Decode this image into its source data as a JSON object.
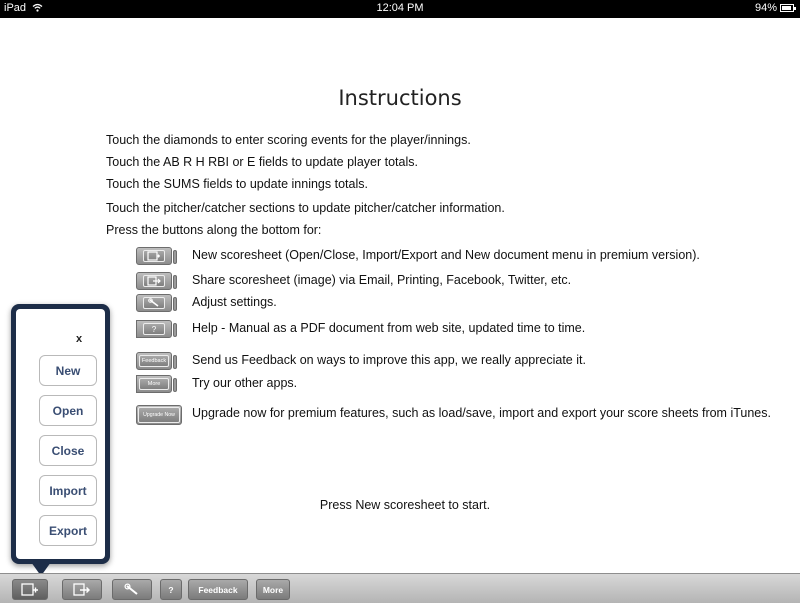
{
  "status_bar": {
    "device": "iPad",
    "time": "12:04 PM",
    "battery": "94%",
    "battery_level": 0.94
  },
  "instructions": {
    "title": "Instructions",
    "lines": [
      "Touch the diamonds to enter scoring events for the player/innings.",
      "Touch the AB R H RBI or E fields to update player totals.",
      "Touch the SUMS fields to update innings totals.",
      "Touch the pitcher/catcher sections to update pitcher/catcher information.",
      "Press the buttons along the bottom for:"
    ],
    "buttons": [
      {
        "icon": "new-scoresheet-icon",
        "label": "",
        "text": "New scoresheet (Open/Close, Import/Export and New document menu in premium version)."
      },
      {
        "icon": "share-icon",
        "label": "",
        "text": "Share scoresheet (image) via Email, Printing, Facebook, Twitter, etc."
      },
      {
        "icon": "wrench-icon",
        "label": "",
        "text": "Adjust settings."
      },
      {
        "icon": "help-icon",
        "label": "?",
        "text": "Help - Manual as a PDF document from web site, updated time to time."
      },
      {
        "icon": "feedback-icon",
        "label": "Feedback",
        "text": "Send us Feedback on ways to improve this app, we really appreciate it."
      },
      {
        "icon": "more-icon",
        "label": "More",
        "text": "Try our other apps."
      },
      {
        "icon": "upgrade-icon",
        "label": "Upgrade Now",
        "text": "Upgrade now for premium features, such as load/save,  import and export your score sheets from iTunes."
      }
    ],
    "start_hint": "Press New scoresheet to start."
  },
  "popover_menu": {
    "close_label": "x",
    "items": [
      "New",
      "Open",
      "Close",
      "Import",
      "Export"
    ]
  },
  "toolbar": {
    "help_label": "?",
    "feedback_label": "Feedback",
    "more_label": "More"
  }
}
